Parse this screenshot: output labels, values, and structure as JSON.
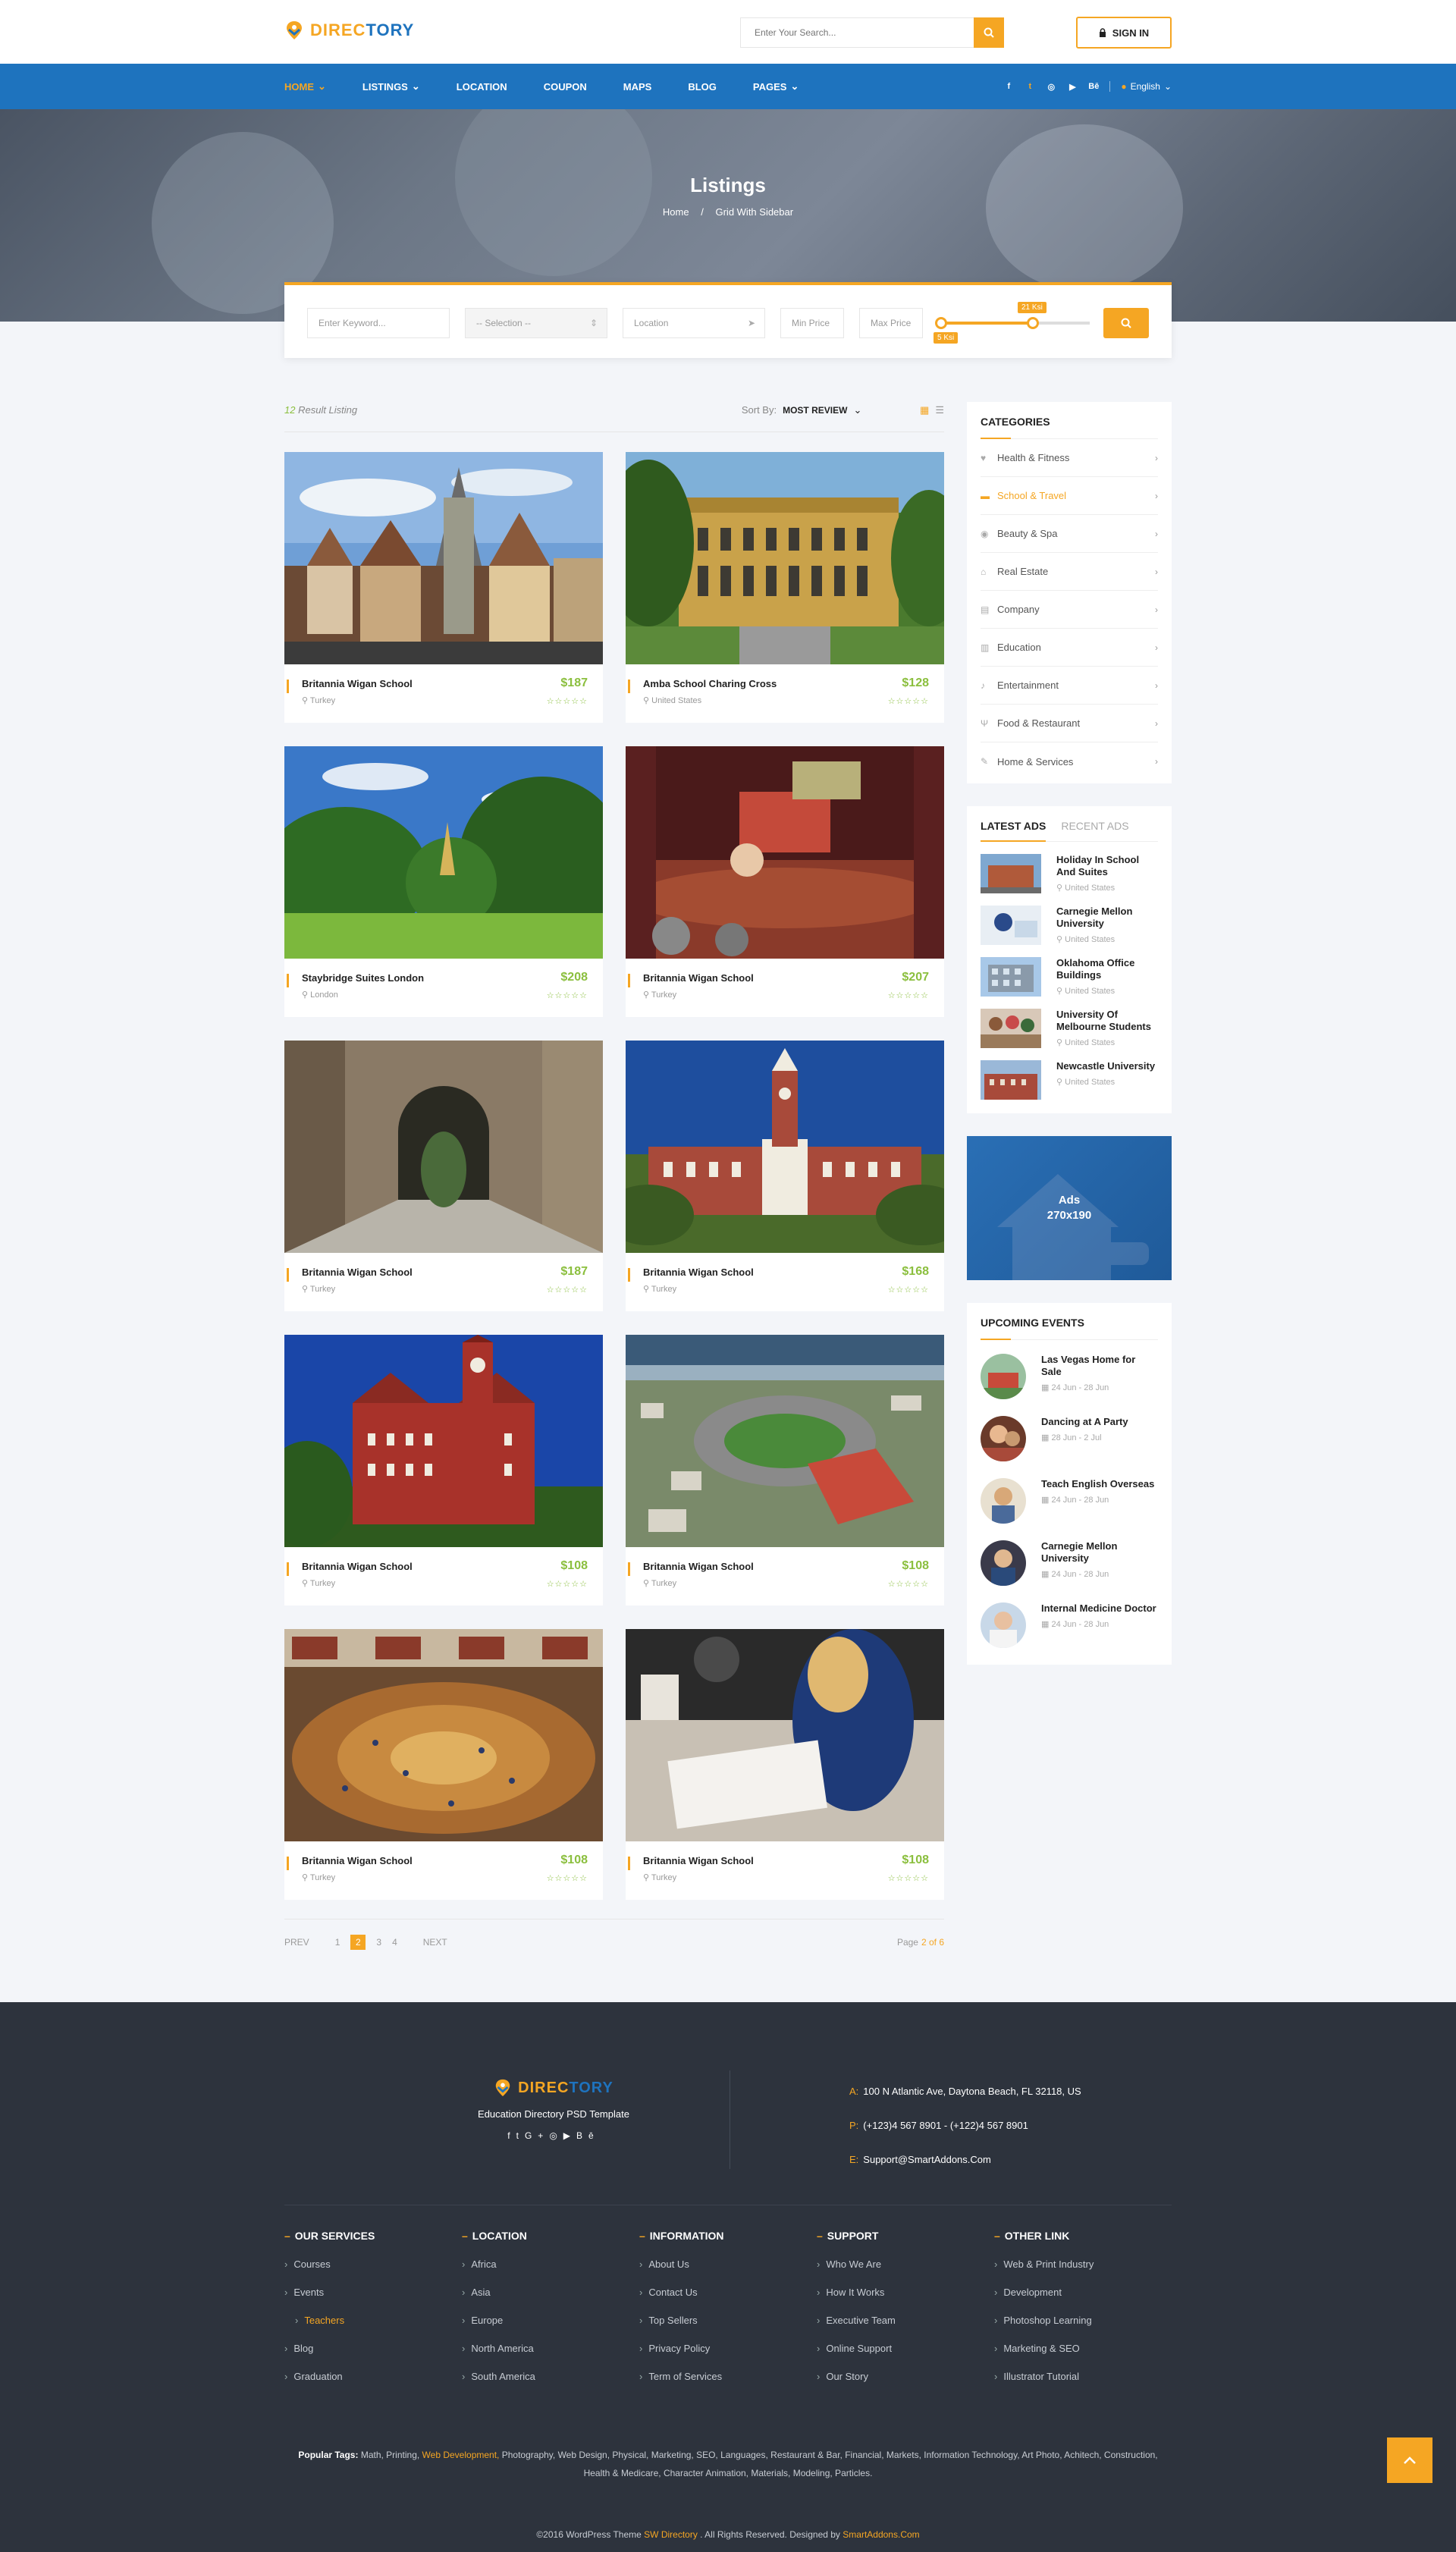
{
  "header": {
    "logo_part1": "DIREC",
    "logo_part2": "TORY",
    "search_placeholder": "Enter Your Search...",
    "signin_label": "SIGN IN"
  },
  "nav": {
    "items": [
      "HOME",
      "LISTINGS",
      "LOCATION",
      "COUPON",
      "MAPS",
      "BLOG",
      "PAGES"
    ],
    "language": "English"
  },
  "hero": {
    "title": "Listings",
    "breadcrumb_home": "Home",
    "breadcrumb_sep": "/",
    "breadcrumb_current": "Grid With Sidebar"
  },
  "filter": {
    "keyword_placeholder": "Enter Keyword...",
    "selection": "-- Selection --",
    "location": "Location",
    "min_price": "Min Price",
    "max_price": "Max Price",
    "range_min": "5 Ksi",
    "range_max": "21 Ksi"
  },
  "results": {
    "count": "12",
    "count_label": "Result Listing",
    "sort_label": "Sort By:",
    "sort_value": "MOST REVIEW"
  },
  "listings": [
    {
      "name": "Britannia Wigan School",
      "location": "Turkey",
      "price": "$187"
    },
    {
      "name": "Amba School Charing Cross",
      "location": "United States",
      "price": "$128"
    },
    {
      "name": "Staybridge Suites London",
      "location": "London",
      "price": "$208"
    },
    {
      "name": "Britannia Wigan School",
      "location": "Turkey",
      "price": "$207"
    },
    {
      "name": "Britannia Wigan School",
      "location": "Turkey",
      "price": "$187"
    },
    {
      "name": "Britannia Wigan School",
      "location": "Turkey",
      "price": "$168"
    },
    {
      "name": "Britannia Wigan School",
      "location": "Turkey",
      "price": "$108"
    },
    {
      "name": "Britannia Wigan School",
      "location": "Turkey",
      "price": "$108"
    },
    {
      "name": "Britannia Wigan School",
      "location": "Turkey",
      "price": "$108"
    },
    {
      "name": "Britannia Wigan School",
      "location": "Turkey",
      "price": "$108"
    }
  ],
  "stars": "☆☆☆☆☆",
  "pagination": {
    "prev": "PREV",
    "pages": [
      "1",
      "2",
      "3",
      "4"
    ],
    "current": "2",
    "next": "NEXT",
    "page_info_prefix": "Page",
    "page_info_value": "2 of 6"
  },
  "sidebar": {
    "categories_title": "CATEGORIES",
    "categories": [
      "Health & Fitness",
      "School & Travel",
      "Beauty & Spa",
      "Real Estate",
      "Company",
      "Education",
      "Entertainment",
      "Food & Restaurant",
      "Home & Services"
    ],
    "tab_latest": "LATEST ADS",
    "tab_recent": "RECENT ADS",
    "ads": [
      {
        "title": "Holiday In School And Suites",
        "location": "United States"
      },
      {
        "title": "Carnegie Mellon University",
        "location": "United States"
      },
      {
        "title": "Oklahoma Office Buildings",
        "location": "United States"
      },
      {
        "title": "University Of Melbourne Students",
        "location": "United States"
      },
      {
        "title": "Newcastle University",
        "location": "United States"
      }
    ],
    "ad_banner_line1": "Ads",
    "ad_banner_line2": "270x190",
    "events_title": "UPCOMING EVENTS",
    "events": [
      {
        "title": "Las Vegas Home for Sale",
        "date": "24 Jun - 28 Jun"
      },
      {
        "title": "Dancing at A Party",
        "date": "28 Jun - 2 Jul"
      },
      {
        "title": "Teach English Overseas",
        "date": "24 Jun - 28 Jun"
      },
      {
        "title": "Carnegie Mellon University",
        "date": "24 Jun - 28 Jun"
      },
      {
        "title": "Internal Medicine Doctor",
        "date": "24 Jun - 28 Jun"
      }
    ]
  },
  "footer": {
    "subtitle": "Education Directory PSD Template",
    "address_label": "A:",
    "address": "100 N Atlantic Ave, Daytona Beach, FL 32118, US",
    "phone_label": "P:",
    "phone": "(+123)4 567 8901 - (+122)4 567 8901",
    "email_label": "E:",
    "email": "Support@SmartAddons.Com",
    "columns": [
      {
        "title": "OUR SERVICES",
        "links": [
          "Courses",
          "Events",
          "Teachers",
          "Blog",
          "Graduation"
        ]
      },
      {
        "title": "LOCATION",
        "links": [
          "Africa",
          "Asia",
          "Europe",
          "North America",
          "South America"
        ]
      },
      {
        "title": "INFORMATION",
        "links": [
          "About Us",
          "Contact Us",
          "Top Sellers",
          "Privacy Policy",
          "Term of Services"
        ]
      },
      {
        "title": "SUPPORT",
        "links": [
          "Who We Are",
          "How It Works",
          "Executive Team",
          "Online Support",
          "Our Story"
        ]
      },
      {
        "title": "OTHER LINK",
        "links": [
          "Web & Print Industry",
          "Development",
          "Photoshop Learning",
          "Marketing & SEO",
          "Illustrator Tutorial"
        ]
      }
    ],
    "popular_label": "Popular Tags:",
    "tags_a": "Math, Printing,",
    "tags_highlight": "Web Development,",
    "tags_b": "Photography, Web Design, Physical, Marketing, SEO, Languages, Restaurant & Bar, Financial, Markets, Information Technology, Art Photo, Achitech, Construction, Health & Medicare, Character Animation, Materials, Modeling, Particles.",
    "copy_a": "©2016 WordPress Theme",
    "copy_brand": "SW Directory",
    "copy_b": ". All Rights Reserved. Designed by",
    "copy_designer": "SmartAddons.Com"
  },
  "colors": {
    "accent": "#f5a623",
    "primary": "#1e73be",
    "green": "#8bbf3e",
    "footer": "#2d333d"
  }
}
